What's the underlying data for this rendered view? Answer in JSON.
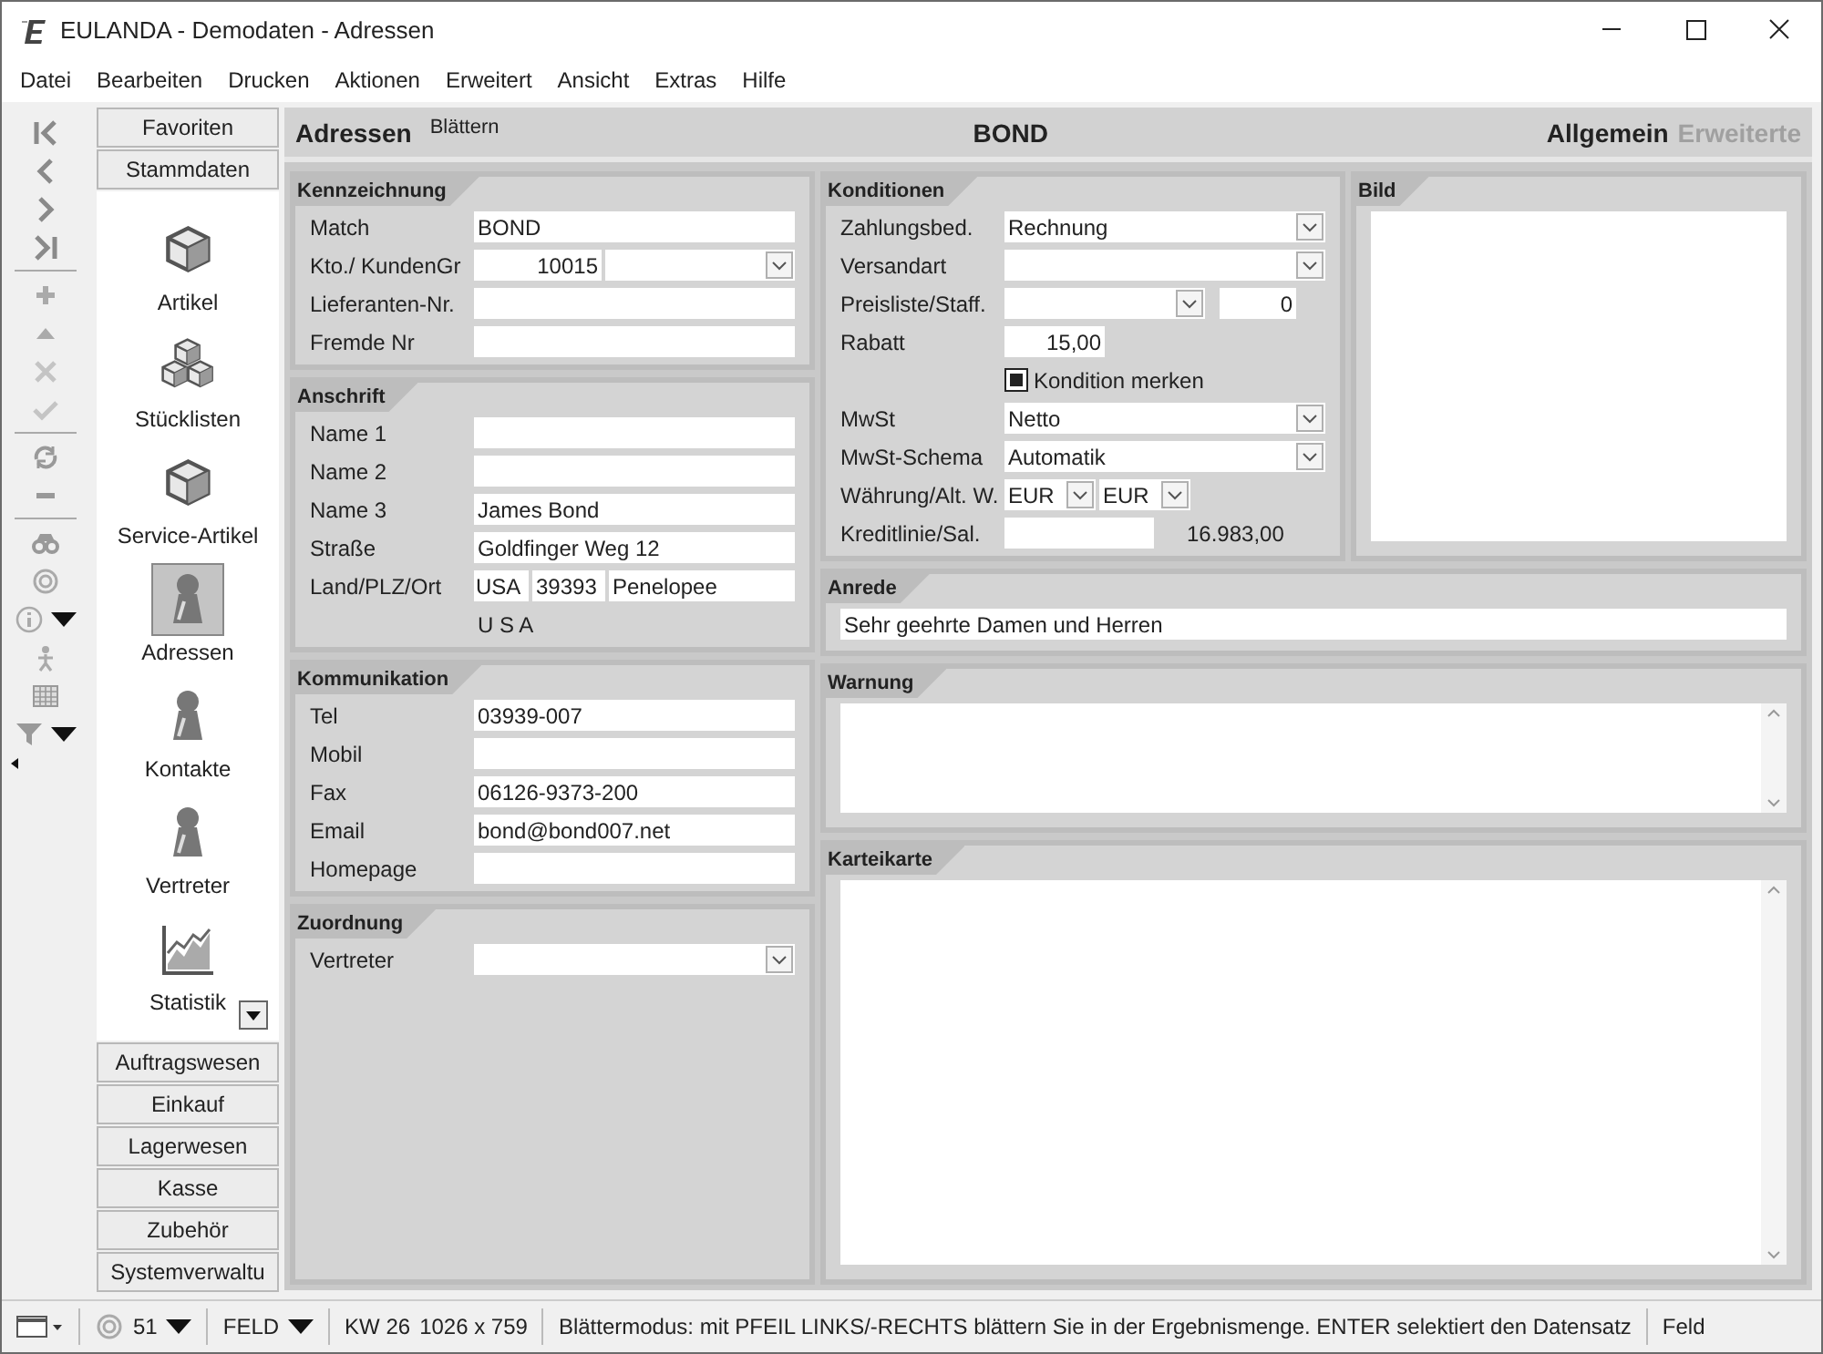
{
  "window": {
    "title": "EULANDA - Demodaten - Adressen"
  },
  "menu": [
    {
      "label": "Datei"
    },
    {
      "label": "Bearbeiten"
    },
    {
      "label": "Drucken"
    },
    {
      "label": "Aktionen"
    },
    {
      "label": "Erweitert"
    },
    {
      "label": "Ansicht"
    },
    {
      "label": "Extras"
    },
    {
      "label": "Hilfe"
    }
  ],
  "modules": {
    "top_tabs": [
      "Favoriten",
      "Stammdaten"
    ],
    "items": [
      {
        "label": "Artikel",
        "selected": false
      },
      {
        "label": "Stücklisten",
        "selected": false
      },
      {
        "label": "Service-Artikel",
        "selected": false
      },
      {
        "label": "Adressen",
        "selected": true
      },
      {
        "label": "Kontakte",
        "selected": false
      },
      {
        "label": "Vertreter",
        "selected": false
      },
      {
        "label": "Statistik",
        "selected": false
      }
    ],
    "bottom_tabs": [
      "Auftragswesen",
      "Einkauf",
      "Lagerwesen",
      "Kasse",
      "Zubehör",
      "Systemverwaltu"
    ]
  },
  "header": {
    "title": "Adressen",
    "mode": "Blättern",
    "record": "BOND",
    "tabs": [
      {
        "label": "Allgemein",
        "selected": true
      },
      {
        "label": "Erweiterte",
        "selected": false
      }
    ]
  },
  "left_groups": [
    {
      "title": "Kennzeichnung",
      "rows": [
        {
          "label": "Match",
          "cells": [
            {
              "kind": "field",
              "value": "BOND"
            }
          ]
        },
        {
          "label": "Kto./ KundenGr",
          "cells": [
            {
              "kind": "num",
              "value": "10015"
            },
            {
              "kind": "combo"
            }
          ]
        },
        {
          "label": "Lieferanten-Nr.",
          "cells": [
            {
              "kind": "field"
            }
          ]
        },
        {
          "label": "Fremde Nr",
          "cells": [
            {
              "kind": "field"
            }
          ]
        }
      ]
    },
    {
      "title": "Anschrift",
      "rows": [
        {
          "label": "Name 1",
          "cells": [
            {
              "kind": "field"
            }
          ]
        },
        {
          "label": "Name 2",
          "cells": [
            {
              "kind": "field"
            }
          ]
        },
        {
          "label": "Name 3",
          "cells": [
            {
              "kind": "field",
              "value": "James Bond"
            }
          ]
        },
        {
          "label": "Straße",
          "cells": [
            {
              "kind": "field",
              "value": "Goldfinger Weg 12"
            }
          ]
        },
        {
          "label": "Land/PLZ/Ort",
          "cells": [
            {
              "kind": "country",
              "value": "USA"
            },
            {
              "kind": "zip",
              "value": "39393"
            },
            {
              "kind": "field",
              "value": "Penelopee"
            }
          ]
        },
        {
          "cells": [
            {
              "kind": "text",
              "value": "U S A"
            }
          ]
        }
      ]
    },
    {
      "title": "Kommunikation",
      "rows": [
        {
          "label": "Tel",
          "cells": [
            {
              "kind": "field",
              "value": "03939-007"
            }
          ]
        },
        {
          "label": "Mobil",
          "cells": [
            {
              "kind": "field"
            }
          ]
        },
        {
          "label": "Fax",
          "cells": [
            {
              "kind": "field",
              "value": "06126-9373-200"
            }
          ]
        },
        {
          "label": "Email",
          "cells": [
            {
              "kind": "field",
              "value": "bond@bond007.net"
            }
          ]
        },
        {
          "label": "Homepage",
          "cells": [
            {
              "kind": "field"
            }
          ]
        }
      ]
    },
    {
      "title": "Zuordnung",
      "rows": [
        {
          "label": "Vertreter",
          "cells": [
            {
              "kind": "combo"
            }
          ]
        }
      ]
    }
  ],
  "konditionen": {
    "title": "Konditionen",
    "rows": [
      {
        "label": "Zahlungsbed.",
        "cells": [
          {
            "kind": "combo",
            "value": "Rechnung"
          }
        ]
      },
      {
        "label": "Versandart",
        "cells": [
          {
            "kind": "combo"
          }
        ]
      },
      {
        "label": "Preisliste/Staff.",
        "cells": [
          {
            "kind": "short_combo"
          },
          {
            "kind": "tiny",
            "value": "0"
          }
        ]
      },
      {
        "label": "Rabatt",
        "cells": [
          {
            "kind": "rate",
            "value": "15,00"
          }
        ]
      },
      {
        "cells": [
          {
            "kind": "check",
            "value": "Kondition merken",
            "checked": true
          }
        ]
      },
      {
        "label": "MwSt",
        "cells": [
          {
            "kind": "combo",
            "value": "Netto"
          }
        ]
      },
      {
        "label": "MwSt-Schema",
        "cells": [
          {
            "kind": "combo",
            "value": "Automatik"
          }
        ]
      },
      {
        "label": "Währung/Alt. W.",
        "cells": [
          {
            "kind": "currency",
            "value": "EUR"
          },
          {
            "kind": "currency",
            "value": "EUR"
          }
        ]
      },
      {
        "label": "Kreditlinie/Sal.",
        "cells": [
          {
            "kind": "credit"
          },
          {
            "kind": "text",
            "value": "16.983,00"
          }
        ]
      }
    ]
  },
  "bild": {
    "title": "Bild"
  },
  "anrede": {
    "title": "Anrede",
    "value": "Sehr geehrte Damen und Herren"
  },
  "warnung": {
    "title": "Warnung"
  },
  "karteikarte": {
    "title": "Karteikarte"
  },
  "status_bar": {
    "count": "51",
    "field_mode": "FELD",
    "week": "KW 26",
    "resolution": "1026 x 759",
    "message": "Blättermodus: mit PFEIL LINKS/-RECHTS blättern Sie in der Ergebnismenge. ENTER selektiert den Datensatz",
    "field": "Feld"
  }
}
